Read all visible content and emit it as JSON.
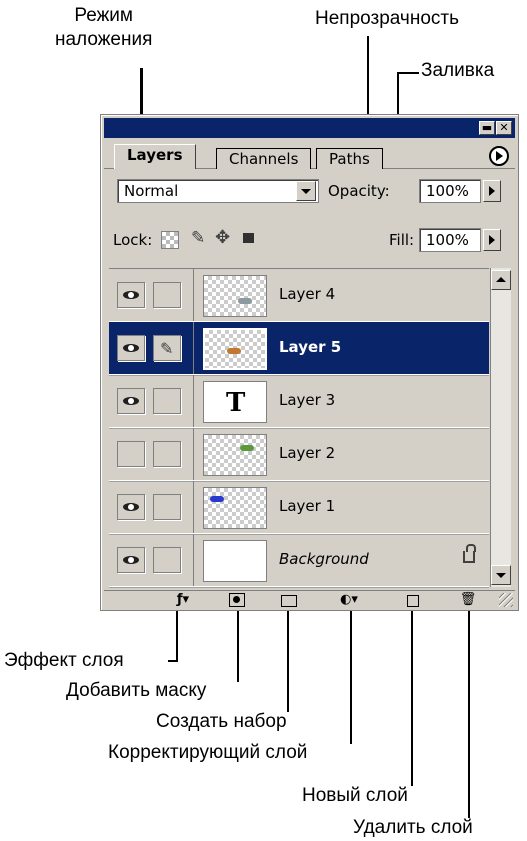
{
  "annotations": {
    "blend_mode": "Режим\nналожения",
    "opacity": "Непрозрачность",
    "fill": "Заливка",
    "layer_effect": "Эффект слоя",
    "add_mask": "Добавить маску",
    "create_set": "Создать набор",
    "adjustment_layer": "Корректирующий слой",
    "new_layer": "Новый слой",
    "delete_layer": "Удалить слой"
  },
  "panel": {
    "tabs": [
      "Layers",
      "Channels",
      "Paths"
    ],
    "active_tab": "Layers",
    "blend_mode": "Normal",
    "opacity_label": "Opacity:",
    "opacity_value": "100%",
    "lock_label": "Lock:",
    "fill_label": "Fill:",
    "fill_value": "100%"
  },
  "layers": [
    {
      "name": "Layer 4",
      "visible": true,
      "selected": false
    },
    {
      "name": "Layer 5",
      "visible": true,
      "selected": true
    },
    {
      "name": "Layer 3",
      "visible": true,
      "selected": false,
      "thumb_glyph": "T"
    },
    {
      "name": "Layer 2",
      "visible": false,
      "selected": false
    },
    {
      "name": "Layer 1",
      "visible": true,
      "selected": false
    },
    {
      "name": "Background",
      "visible": true,
      "selected": false,
      "locked": true
    }
  ],
  "colors": {
    "titlebar": "#0a246a",
    "selection": "#0a246a",
    "panel_bg": "#d4d0c8"
  }
}
